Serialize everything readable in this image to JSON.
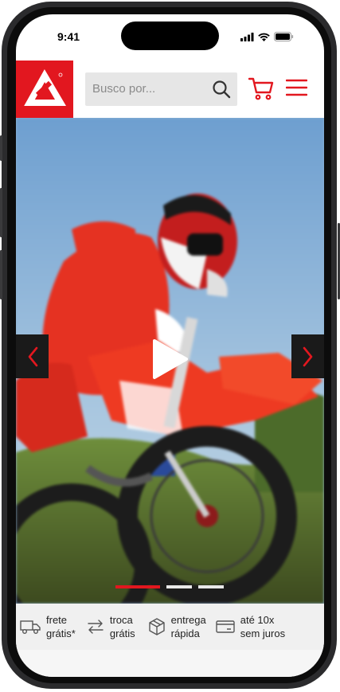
{
  "status_bar": {
    "time": "9:41"
  },
  "header": {
    "search": {
      "placeholder": "Busco por..."
    }
  },
  "features": [
    {
      "label_line1": "frete",
      "label_line2": "grátis*"
    },
    {
      "label_line1": "troca",
      "label_line2": "grátis"
    },
    {
      "label_line1": "entrega",
      "label_line2": "rápida"
    },
    {
      "label_line1": "até 10x",
      "label_line2": "sem juros"
    }
  ],
  "carousel": {
    "total_slides": 3,
    "active_slide": 1
  },
  "colors": {
    "brand_red": "#e2171f",
    "search_bg": "#e6e6e6",
    "features_bg": "#f0f0f0"
  }
}
